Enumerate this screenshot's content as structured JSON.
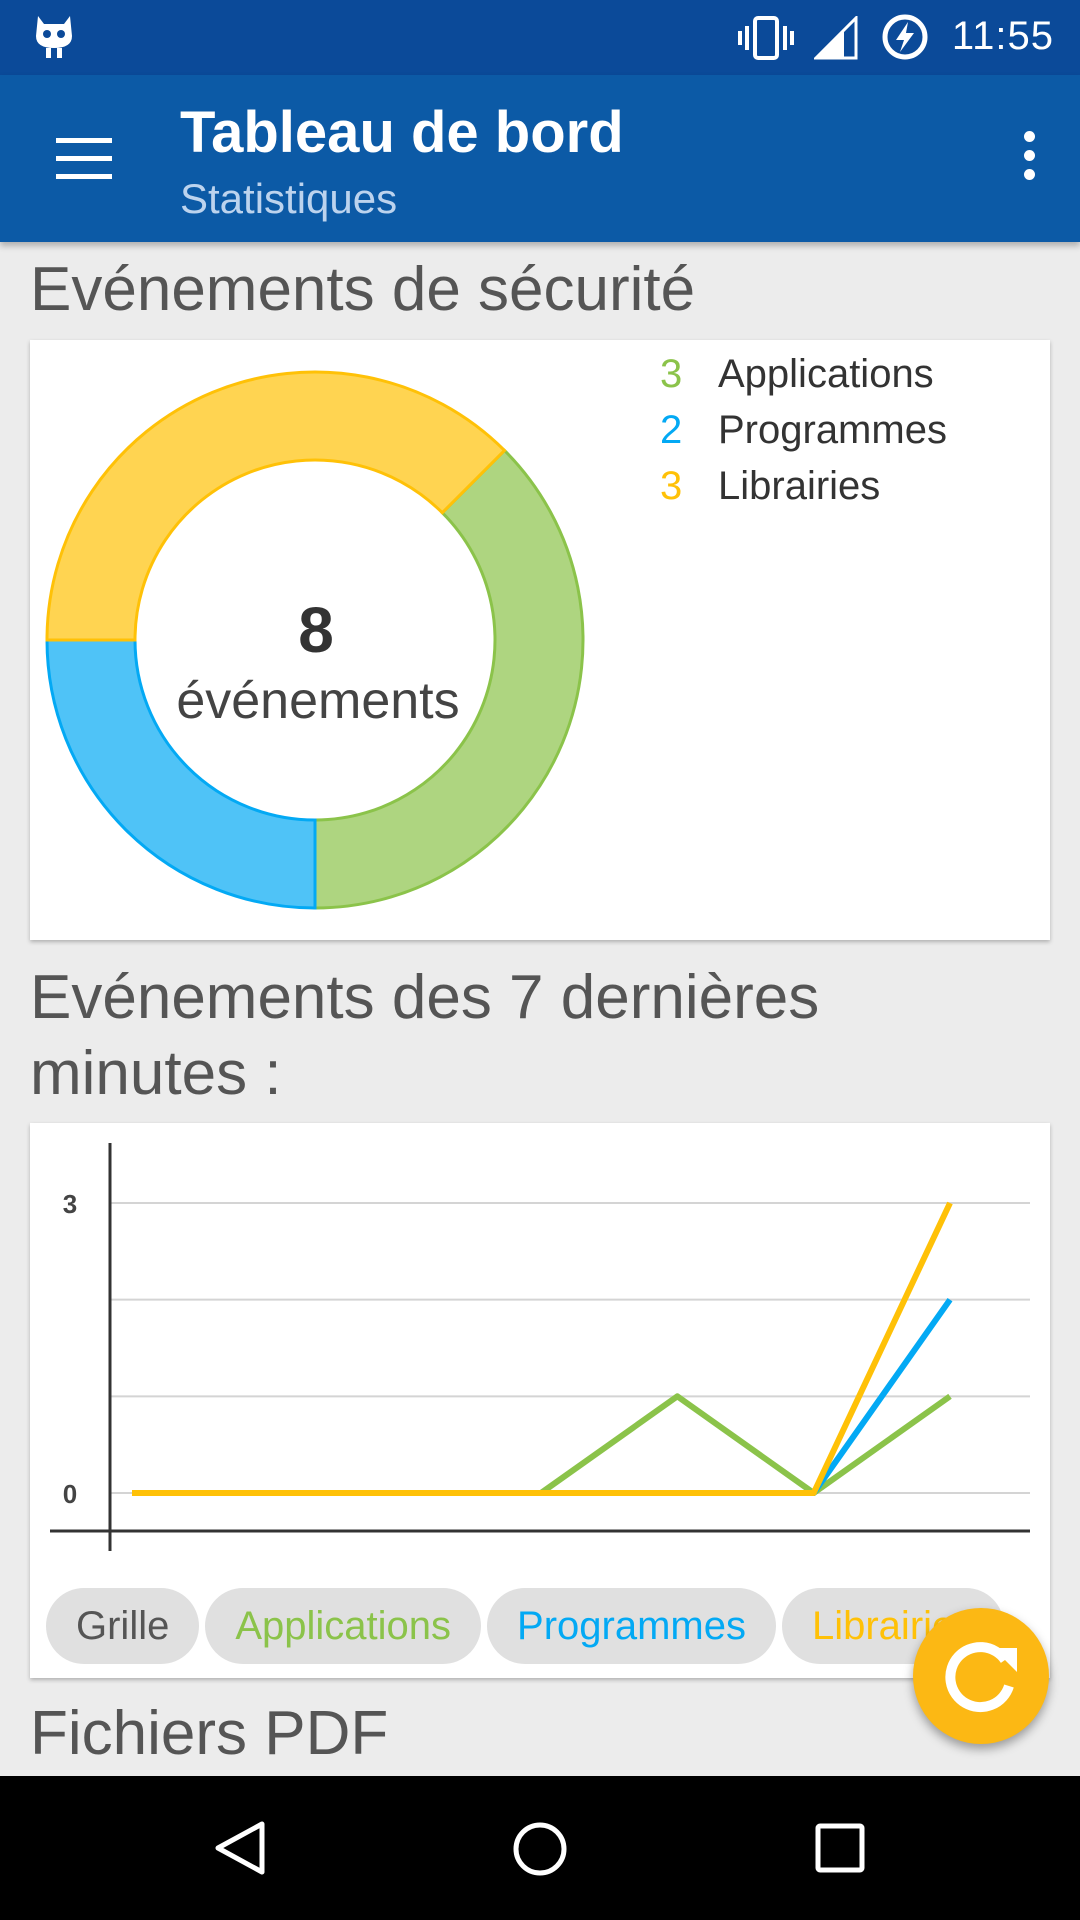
{
  "status_bar": {
    "time": "11:55",
    "icons": [
      "cyanogen-icon",
      "vibrate-icon",
      "signal-icon",
      "battery-charging-icon"
    ]
  },
  "app_bar": {
    "title": "Tableau de bord",
    "subtitle": "Statistiques"
  },
  "security": {
    "heading": "Evénements de sécurité",
    "total": "8",
    "total_label": "événements",
    "legend": [
      {
        "count": "3",
        "label": "Applications",
        "color": "#8bc34a"
      },
      {
        "count": "2",
        "label": "Programmes",
        "color": "#03a9f4"
      },
      {
        "count": "3",
        "label": "Librairies",
        "color": "#ffc107"
      }
    ]
  },
  "recent": {
    "heading_line1": "Evénements des 7 dernières",
    "heading_line2": "minutes :",
    "chips": [
      {
        "label": "Grille",
        "color": "#555555"
      },
      {
        "label": "Applications",
        "color": "#8bc34a"
      },
      {
        "label": "Programmes",
        "color": "#03a9f4"
      },
      {
        "label": "Librairies",
        "color": "#ffc107"
      }
    ]
  },
  "pdf": {
    "heading": "Fichiers PDF"
  },
  "colors": {
    "status_bar": "#0b4a99",
    "app_bar": "#0c5aa6",
    "fab": "#fcb814"
  },
  "chart_data": [
    {
      "type": "pie",
      "style": "donut",
      "categories": [
        "Applications",
        "Programmes",
        "Librairies"
      ],
      "values": [
        3,
        2,
        3
      ],
      "colors": [
        "#8bc34a",
        "#03a9f4",
        "#ffc107"
      ],
      "center_text": "8"
    },
    {
      "type": "line",
      "x": [
        1,
        2,
        3,
        4,
        5,
        6,
        7
      ],
      "series": [
        {
          "name": "Applications",
          "color": "#8bc34a",
          "values": [
            0,
            0,
            0,
            0,
            1,
            0,
            1
          ]
        },
        {
          "name": "Programmes",
          "color": "#03a9f4",
          "values": [
            0,
            0,
            0,
            0,
            0,
            0,
            2
          ]
        },
        {
          "name": "Librairies",
          "color": "#ffc107",
          "values": [
            0,
            0,
            0,
            0,
            0,
            0,
            3
          ]
        }
      ],
      "ylim": [
        0,
        3
      ],
      "yticks": [
        "0",
        "3"
      ],
      "grid": true
    }
  ]
}
